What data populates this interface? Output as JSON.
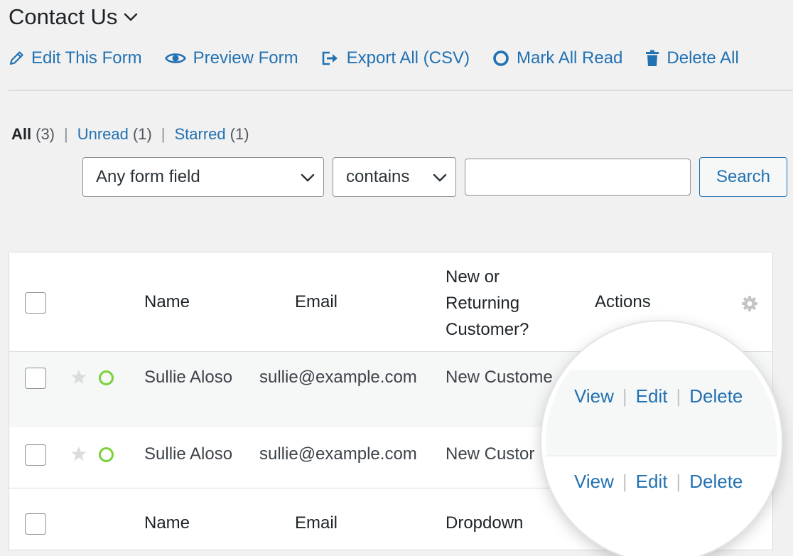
{
  "header": {
    "title": "Contact Us"
  },
  "toolbar": {
    "edit_form": "Edit This Form",
    "preview_form": "Preview Form",
    "export_all": "Export All (CSV)",
    "mark_all_read": "Mark All Read",
    "delete_all": "Delete All"
  },
  "filters": {
    "all_label": "All",
    "all_count": "(3)",
    "unread_label": "Unread",
    "unread_count": "(1)",
    "starred_label": "Starred",
    "starred_count": "(1)",
    "separator": "|"
  },
  "search": {
    "field_select": "Any form field",
    "operator_select": "contains",
    "query_value": "",
    "button_label": "Search"
  },
  "table": {
    "header": {
      "name": "Name",
      "email": "Email",
      "customer_line1": "New or",
      "customer_line2": "Returning",
      "customer_line3": "Customer?",
      "actions": "Actions"
    },
    "rows": [
      {
        "name": "Sullie Aloso",
        "email": "sullie@example.com",
        "customer": "New Custome"
      },
      {
        "name": "Sullie Aloso",
        "email": "sullie@example.com",
        "customer": "New Custor"
      }
    ],
    "footer": {
      "name": "Name",
      "email": "Email",
      "customer": "Dropdown"
    },
    "actions": {
      "view": "View",
      "edit": "Edit",
      "delete": "Delete",
      "separator": "|"
    }
  },
  "colors": {
    "link": "#2271b1",
    "unread_dot": "#7ad03a",
    "star": "#dcdcde",
    "background": "#f1f1f2"
  }
}
